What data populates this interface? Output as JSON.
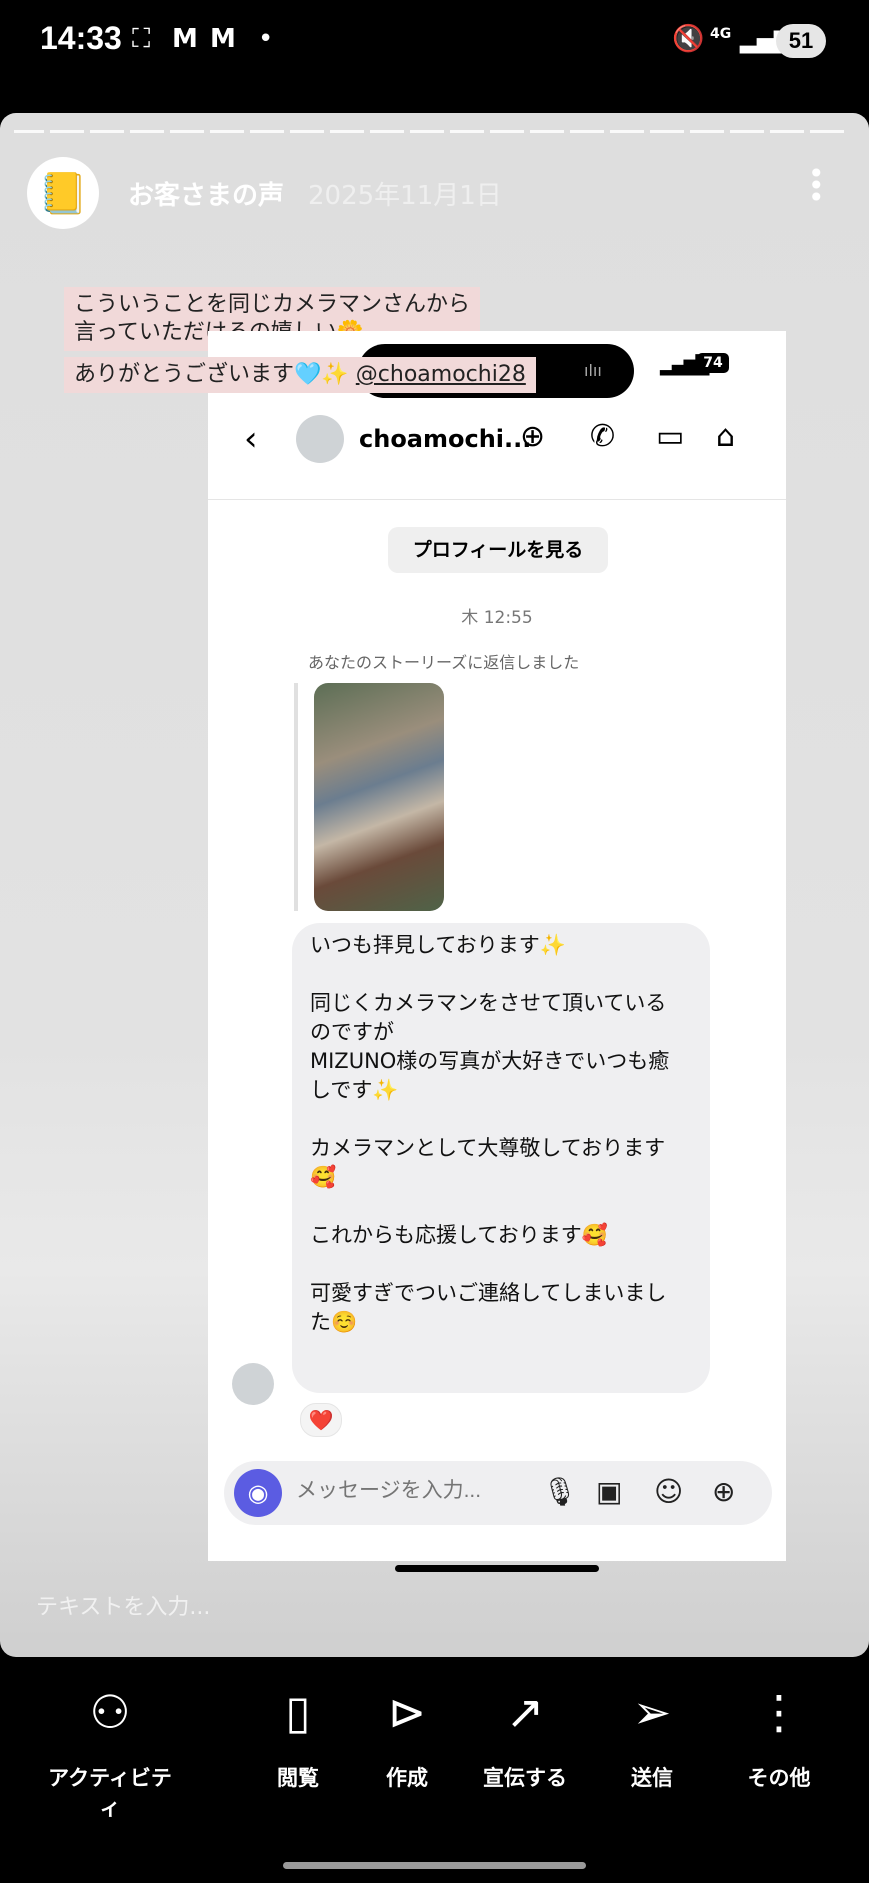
{
  "status_bar": {
    "time": "14:33",
    "icons": [
      "screenshot-icon",
      "gmail-icon",
      "gmail-icon",
      "dot-icon"
    ],
    "network": "4G",
    "battery": "51"
  },
  "story": {
    "username": "お客さまの声",
    "date": "2025年11月1日",
    "captions": [
      {
        "line1": "こういうことを同じカメラマンさんから",
        "line2": "言っていただけるの嬉しい🌼"
      },
      {
        "text": "ありがとうございます🩵✨",
        "mention": "@choamochi28"
      }
    ],
    "text_input_placeholder": "テキストを入力..."
  },
  "screenshot": {
    "battery": "74",
    "dm_username": "choamochi...",
    "profile_button": "プロフィールを見る",
    "timestamp": "木 12:55",
    "replied_label": "あなたのストーリーズに返信しました",
    "message_lines": [
      "いつも拝見しております✨",
      "",
      "同じくカメラマンをさせて頂いている",
      "のですが",
      "MIZUNO様の写真が大好きでいつも癒",
      "しです✨",
      "",
      "カメラマンとして大尊敬しております",
      "🥰",
      "",
      "これからも応援しております🥰",
      "",
      "可愛すぎでついご連絡してしまいまし",
      "た☺️"
    ],
    "reaction": "❤️",
    "message_placeholder": "メッセージを入力..."
  },
  "bottom_nav": [
    {
      "label": "アクティビティ",
      "icon": "activity-icon"
    },
    {
      "label": "閲覧",
      "icon": "views-icon"
    },
    {
      "label": "作成",
      "icon": "create-icon"
    },
    {
      "label": "宣伝する",
      "icon": "promote-icon"
    },
    {
      "label": "送信",
      "icon": "send-icon"
    },
    {
      "label": "その他",
      "icon": "more-icon"
    }
  ]
}
